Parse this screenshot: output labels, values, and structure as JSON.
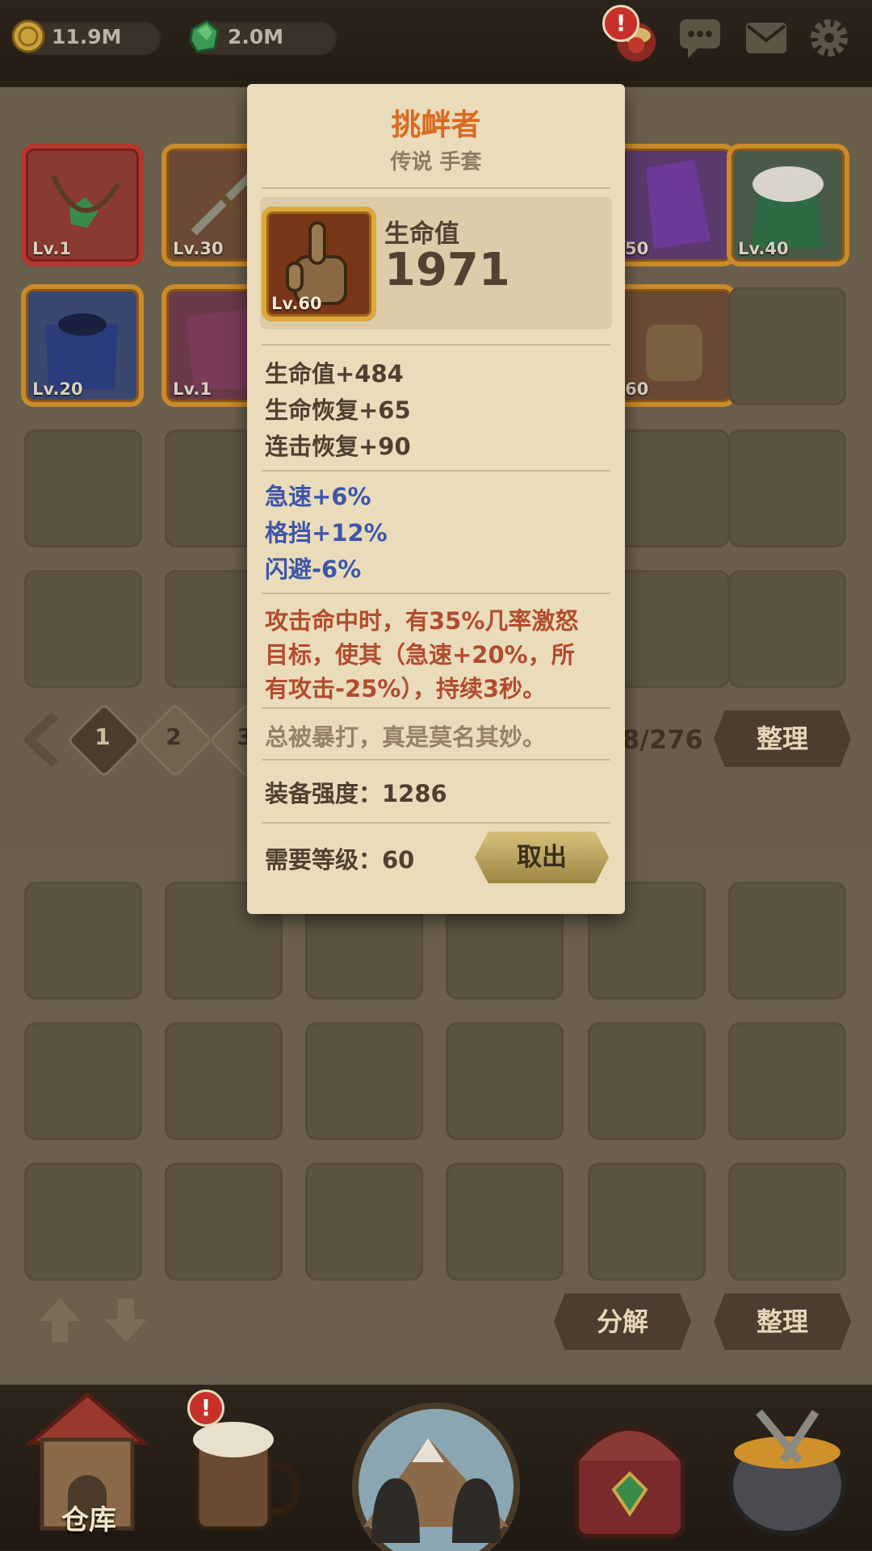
{
  "header": {
    "gold_amount": "11.9M",
    "gem_amount": "2.0M",
    "icons": [
      "coin-icon",
      "emerald-icon",
      "event-icon",
      "chat-icon",
      "mail-icon",
      "settings-icon"
    ],
    "alert_symbol": "!"
  },
  "inventory": {
    "items": [
      {
        "level": "Lv.1"
      },
      {
        "level": "Lv.30"
      },
      {
        "level": "50"
      },
      {
        "level": "Lv.40"
      },
      {
        "level": "Lv.20"
      },
      {
        "level": "Lv.1"
      },
      {
        "level": "60"
      }
    ],
    "pages": [
      "1",
      "2",
      "3"
    ],
    "count": "8/276",
    "sort_label": "整理"
  },
  "storage": {
    "decompose_label": "分解",
    "sort_label": "整理"
  },
  "bottom_nav": {
    "warehouse_label": "仓库",
    "alert_symbol": "!"
  },
  "tooltip": {
    "name": "挑衅者",
    "rarity_type": "传说 手套",
    "item_level": "Lv.60",
    "main_stat_label": "生命值",
    "main_stat_value": "1971",
    "base_stats": [
      "生命值+484",
      "生命恢复+65",
      "连击恢复+90"
    ],
    "bonus_stats": [
      "急速+6%",
      "格挡+12%",
      "闪避-6%"
    ],
    "effect_lines": [
      "攻击命中时，有35%几率激怒",
      "目标，使其（急速+20%，所",
      "有攻击-25%），持续3秒。"
    ],
    "flavor_text": "总被暴打，真是莫名其妙。",
    "power_text": "装备强度：1286",
    "required_level_text": "需要等级：60",
    "take_out_label": "取出"
  },
  "colors": {
    "title_orange": "#d96b22",
    "bonus_blue": "#3e56a8",
    "effect_red": "#b24c2e",
    "parchment": "#eadcbb"
  }
}
